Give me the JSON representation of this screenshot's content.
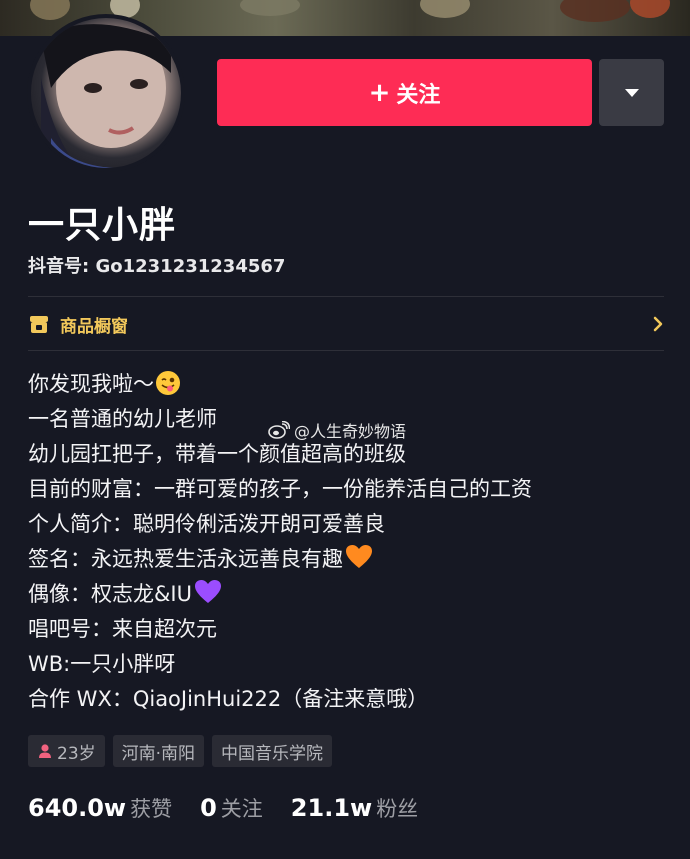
{
  "profile": {
    "nickname": "一只小胖",
    "douyin_id": "抖音号: Go1231231234567",
    "follow_label": "关注",
    "follow_plus": "+"
  },
  "shop": {
    "label": "商品橱窗"
  },
  "bio": {
    "lines": [
      "你发现我啦～",
      "一名普通的幼儿老师",
      "幼儿园扛把子，带着一个颜值超高的班级",
      "目前的财富：一群可爱的孩子，一份能养活自己的工资",
      "个人简介：聪明伶俐活泼开朗可爱善良",
      "签名：永远热爱生活永远善良有趣",
      "偶像：权志龙&IU",
      "唱吧号：来自超次元",
      "WB:一只小胖呀",
      "合作 WX：QiaoJinHui222（备注来意哦）"
    ]
  },
  "watermark": {
    "text": "@人生奇妙物语"
  },
  "tags": {
    "age": "23岁",
    "location": "河南·南阳",
    "school": "中国音乐学院"
  },
  "stats": {
    "likes_num": "640.0w",
    "likes_label": "获赞",
    "following_num": "0",
    "following_label": "关注",
    "followers_num": "21.1w",
    "followers_label": "粉丝"
  },
  "colors": {
    "accent": "#fe2c55",
    "background": "#161823",
    "shop": "#f2c85b",
    "orange_heart": "#ff8a1f",
    "purple_heart": "#9b4dff"
  },
  "icons": {
    "emoji_1": "winking-tongue-emoji",
    "emoji_2": "orange-heart-emoji",
    "emoji_3": "purple-heart-emoji",
    "shop": "storefront-icon",
    "more": "triangle-down-icon",
    "chevron": "chevron-right-icon",
    "gender": "female-icon",
    "watermark": "weibo-icon"
  }
}
